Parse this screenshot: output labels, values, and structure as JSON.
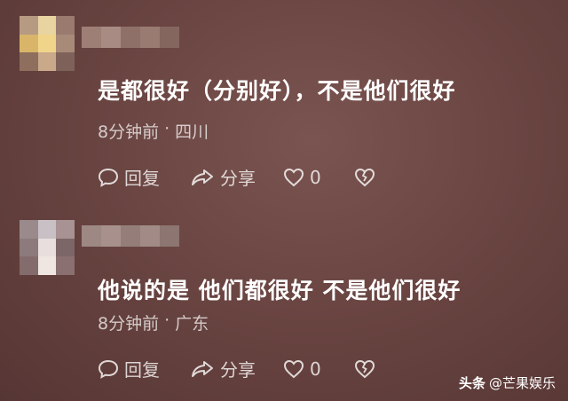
{
  "comments": [
    {
      "text": "是都很好（分别好），不是他们很好",
      "time": "8分钟前",
      "location": "四川",
      "reply_label": "回复",
      "share_label": "分享",
      "like_count": "0"
    },
    {
      "text": "他说的是 他们都很好 不是他们很好",
      "time": "8分钟前",
      "location": "广东",
      "reply_label": "回复",
      "share_label": "分享",
      "like_count": "0"
    }
  ],
  "meta_separator": "·",
  "watermark": {
    "platform": "头条",
    "account": "@芒果娱乐"
  },
  "icons": [
    "comment-icon",
    "share-arrow-icon",
    "heart-outline-icon",
    "broken-heart-icon"
  ],
  "colors": {
    "background": "#6a4542",
    "text": "#ffffff",
    "meta_text": "#d6c2c0"
  }
}
